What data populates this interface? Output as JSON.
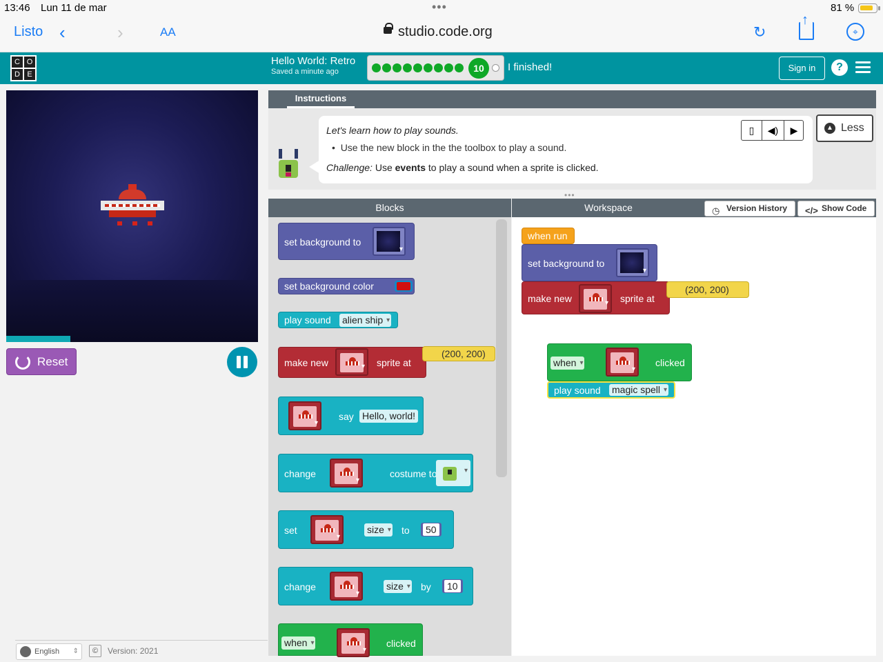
{
  "status": {
    "time": "13:46",
    "date": "Lun 11 de mar",
    "battery": "81 %",
    "more": "•••"
  },
  "safari": {
    "done": "Listo",
    "back": "‹",
    "forward": "›",
    "text_size": "AA",
    "url": "studio.code.org",
    "reload": "↻",
    "compass": "⌖"
  },
  "header": {
    "logo_letters": [
      "C",
      "O",
      "D",
      "E"
    ],
    "level_title": "Hello World: Retro",
    "saved": "Saved a minute ago",
    "progress_current": "10",
    "progress_completed": 9,
    "finished": "I finished!",
    "sign_in": "Sign in",
    "help": "?"
  },
  "game": {
    "reset": "Reset"
  },
  "footer": {
    "language": "English",
    "copyright": "©",
    "version": "Version: 2021"
  },
  "instructions": {
    "tab": "Instructions",
    "line1": "Let's learn how to play sounds.",
    "bullet": "Use the new block in the the toolbox to play a sound.",
    "challenge_label": "Challenge:",
    "challenge_pre": " Use ",
    "challenge_bold": "events",
    "challenge_post": " to play a sound when a sprite is clicked.",
    "less": "Less"
  },
  "toolbox": {
    "title": "Blocks",
    "set_background_to": "set background to",
    "set_background_color": "set background color",
    "play_sound": "play sound",
    "sound_alien": "alien ship",
    "make_new": "make new",
    "sprite_at": "sprite at",
    "coords": "(200, 200)",
    "say": "say",
    "say_text": "Hello, world!",
    "change": "change",
    "costume_to": "costume to",
    "set": "set",
    "size": "size",
    "to": "to",
    "fifty": "50",
    "by": "by",
    "ten": "10",
    "when": "when",
    "clicked": "clicked"
  },
  "workspace": {
    "title": "Workspace",
    "version_history": "Version History",
    "show_code": "Show Code",
    "when_run": "when run",
    "set_background_to": "set background to",
    "make_new": "make new",
    "sprite_at": "sprite at",
    "coords": "(200, 200)",
    "when": "when",
    "clicked": "clicked",
    "play_sound": "play sound",
    "sound_magic": "magic spell"
  },
  "colors": {
    "header": "#0094a0",
    "reset": "#9a59b5",
    "purple_block": "#5b5fa8",
    "red_block": "#b32c35",
    "teal_block": "#19b2c3",
    "green_block": "#22b24c",
    "orange_block": "#f5a21b"
  }
}
